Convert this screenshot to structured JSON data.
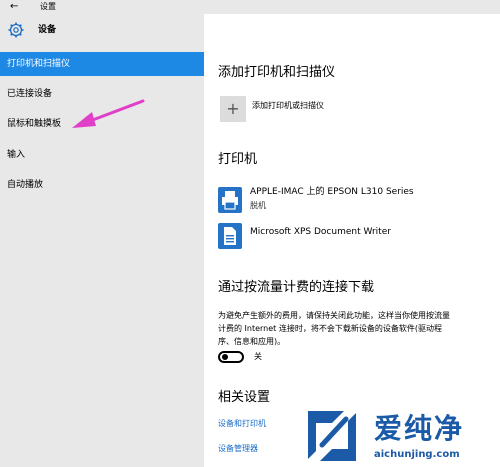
{
  "titlebar": {
    "back_glyph": "←",
    "title": "设置"
  },
  "sidebar": {
    "header_label": "设备",
    "items": [
      {
        "label": "打印机和扫描仪",
        "active": true
      },
      {
        "label": "已连接设备"
      },
      {
        "label": "鼠标和触摸板"
      },
      {
        "label": "输入"
      },
      {
        "label": "自动播放"
      }
    ]
  },
  "main": {
    "section_add": {
      "title": "添加打印机和扫描仪",
      "add_glyph": "+",
      "add_label": "添加打印机或扫描仪"
    },
    "section_printers": {
      "title": "打印机",
      "printers": [
        {
          "name": "APPLE-IMAC 上的 EPSON L310 Series",
          "status": "脱机"
        },
        {
          "name": "Microsoft XPS Document Writer",
          "status": ""
        }
      ]
    },
    "section_metered": {
      "title": "通过按流量计费的连接下载",
      "desc_line1": "为避免产生额外的费用，请保持关闭此功能，这样当你使用按流量",
      "desc_line2": "计费的 Internet 连接时，将不会下载新设备的设备软件(驱动程",
      "desc_line3": "序、信息和应用)。",
      "toggle_state": "关"
    },
    "section_related": {
      "title": "相关设置",
      "links": [
        "设备和打印机",
        "设备管理器"
      ]
    }
  },
  "watermark": {
    "brand": "爱纯净",
    "url": "aichunjing.com"
  },
  "colors": {
    "accent": "#1e88e5",
    "link": "#1a6ec7",
    "annotation": "#e040c8"
  }
}
